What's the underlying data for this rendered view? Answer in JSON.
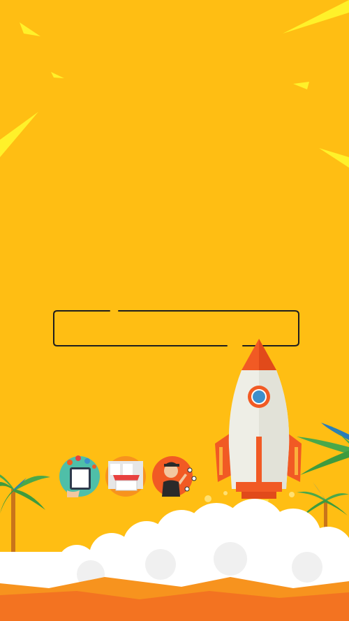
{
  "title_frame": {
    "text": ""
  },
  "icons": [
    {
      "name": "tablet-shopping-icon"
    },
    {
      "name": "storefront-icon"
    },
    {
      "name": "person-waving-icon"
    }
  ],
  "colors": {
    "background": "#FFBE13",
    "ray": "#FFF12A",
    "rocket_body": "#EEEEE6",
    "rocket_accent": "#F15A24",
    "palm_leaf": "#4AA84A",
    "cloud": "#FFFFFF",
    "ground": "#F7931E"
  }
}
